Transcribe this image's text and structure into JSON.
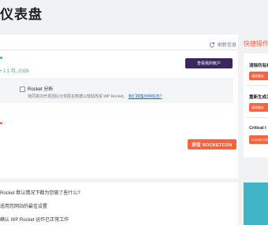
{
  "header": {
    "title": "仪表盘"
  },
  "toolbar": {
    "refresh_label": "刷新信息"
  },
  "account": {
    "date_text": "• 1 1 月, 2026",
    "account_button": "查看我的帐户"
  },
  "analytics": {
    "label": "Rocket 分析",
    "description": "我同意向开发团队分享匿名数据以帮助改进 WP Rocket。",
    "link_text": "我们搜集何种信息?"
  },
  "license": {
    "button_label": "获取 ROCKETCDN"
  },
  "faq": {
    "items": [
      "Rocket 默认情况下都为您做了些什么?",
      "适用您网站的最佳设置",
      "确认 WP Rocket 运作已正常工作"
    ]
  },
  "quick_actions": {
    "title": "快捷操作",
    "items": [
      {
        "label": "清除所有缓",
        "button": "清除缓存"
      },
      {
        "label": "重新生成关",
        "button": "清除缓存"
      },
      {
        "label": "Critical I",
        "button": "CLEAR CRI"
      }
    ]
  },
  "colors": {
    "accent": "#f56640",
    "dark": "#3a2660",
    "green": "#3cb08a",
    "teal": "#40b5c8"
  }
}
